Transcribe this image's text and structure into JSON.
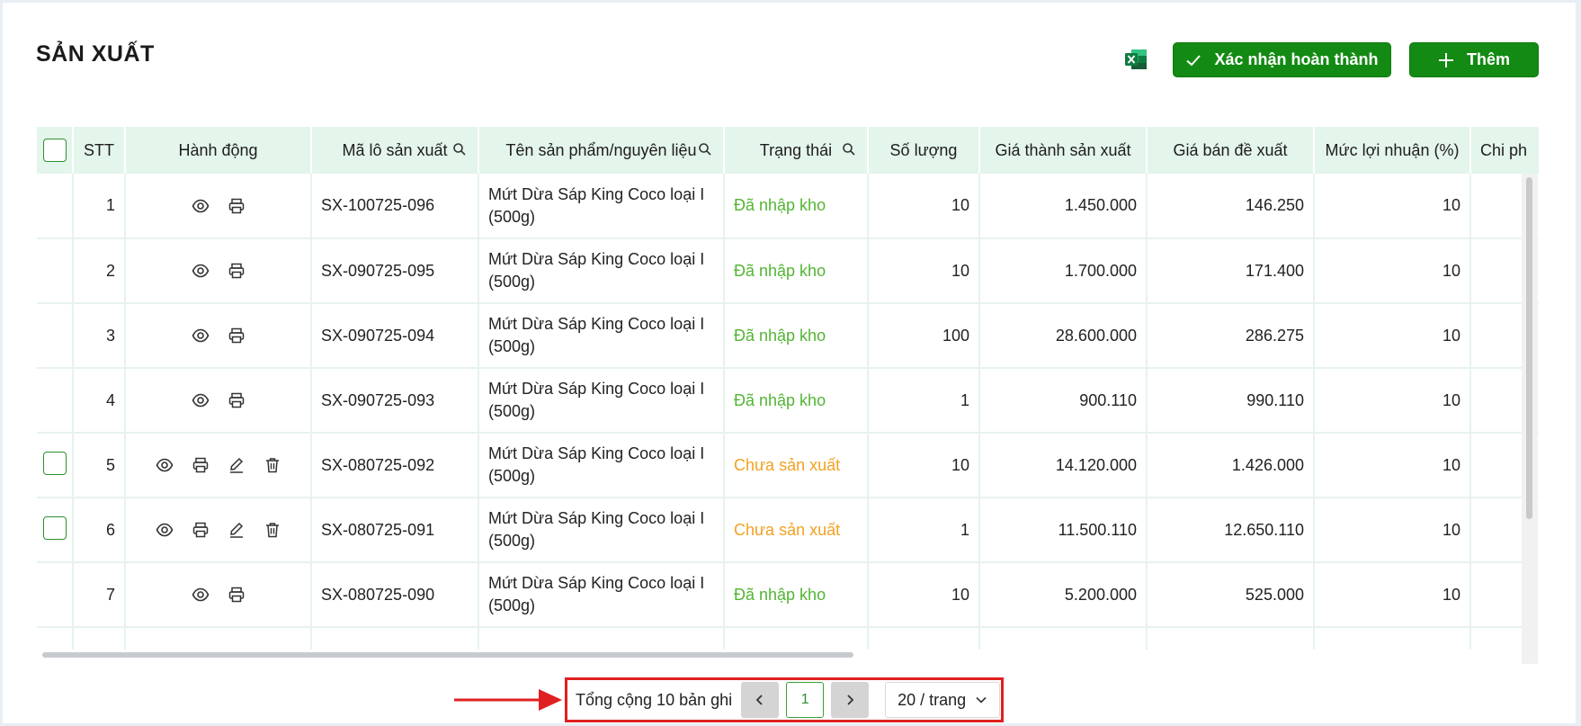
{
  "page": {
    "title": "SẢN XUẤT"
  },
  "toolbar": {
    "confirm_label": "Xác nhận hoàn thành",
    "add_label": "Thêm"
  },
  "colors": {
    "primary": "#138a13",
    "header_bg": "#e4f5eb",
    "status_done": "#52b533",
    "status_pending": "#f2a122"
  },
  "table": {
    "columns": {
      "stt": "STT",
      "actions": "Hành động",
      "batch": "Mã lô sản xuất",
      "product": "Tên sản phẩm/nguyên liệu",
      "status": "Trạng thái",
      "qty": "Số lượng",
      "cost": "Giá thành sản xuất",
      "price": "Giá bán đề xuất",
      "profit": "Mức lợi nhuận (%)",
      "extra": "Chi ph"
    },
    "rows": [
      {
        "stt": "1",
        "batch": "SX-100725-096",
        "product": "Mứt Dừa Sáp King Coco loại I (500g)",
        "status": "Đã nhập kho",
        "status_type": "done",
        "qty": "10",
        "cost": "1.450.000",
        "price": "146.250",
        "profit": "10",
        "editable": false
      },
      {
        "stt": "2",
        "batch": "SX-090725-095",
        "product": "Mứt Dừa Sáp King Coco loại I (500g)",
        "status": "Đã nhập kho",
        "status_type": "done",
        "qty": "10",
        "cost": "1.700.000",
        "price": "171.400",
        "profit": "10",
        "editable": false
      },
      {
        "stt": "3",
        "batch": "SX-090725-094",
        "product": "Mứt Dừa Sáp King Coco loại I (500g)",
        "status": "Đã nhập kho",
        "status_type": "done",
        "qty": "100",
        "cost": "28.600.000",
        "price": "286.275",
        "profit": "10",
        "editable": false
      },
      {
        "stt": "4",
        "batch": "SX-090725-093",
        "product": "Mứt Dừa Sáp King Coco loại I (500g)",
        "status": "Đã nhập kho",
        "status_type": "done",
        "qty": "1",
        "cost": "900.110",
        "price": "990.110",
        "profit": "10",
        "editable": false
      },
      {
        "stt": "5",
        "batch": "SX-080725-092",
        "product": "Mứt Dừa Sáp King Coco loại I (500g)",
        "status": "Chưa sản xuất",
        "status_type": "pending",
        "qty": "10",
        "cost": "14.120.000",
        "price": "1.426.000",
        "profit": "10",
        "editable": true
      },
      {
        "stt": "6",
        "batch": "SX-080725-091",
        "product": "Mứt Dừa Sáp King Coco loại I (500g)",
        "status": "Chưa sản xuất",
        "status_type": "pending",
        "qty": "1",
        "cost": "11.500.110",
        "price": "12.650.110",
        "profit": "10",
        "editable": true
      },
      {
        "stt": "7",
        "batch": "SX-080725-090",
        "product": "Mứt Dừa Sáp King Coco loại I (500g)",
        "status": "Đã nhập kho",
        "status_type": "done",
        "qty": "10",
        "cost": "5.200.000",
        "price": "525.000",
        "profit": "10",
        "editable": false
      }
    ]
  },
  "pagination": {
    "total_text": "Tổng cộng 10 bản ghi",
    "current_page": "1",
    "page_size": "20 / trang"
  }
}
